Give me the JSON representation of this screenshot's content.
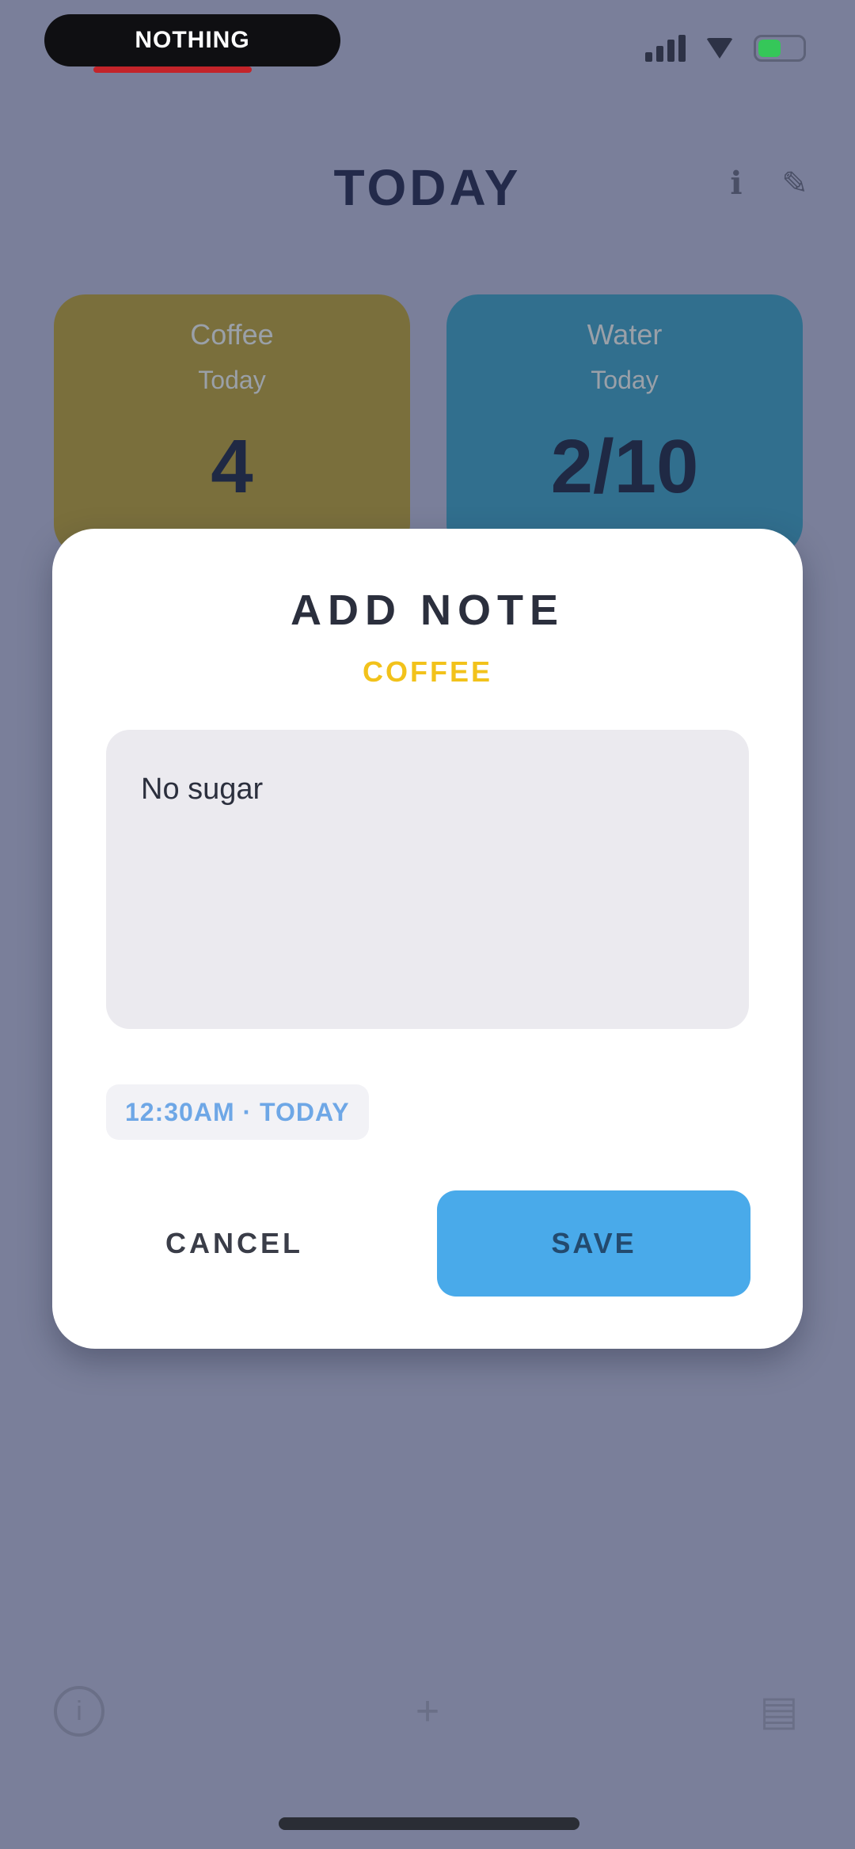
{
  "status_bar": {
    "brand_text": "NOTHING",
    "colors": {
      "battery": "#35c759",
      "brand_underline": "#c3242a"
    }
  },
  "header": {
    "title": "TODAY",
    "icons": [
      "info-icon",
      "edit-icon"
    ]
  },
  "cards": [
    {
      "label": "Coffee",
      "sub": "Today",
      "value": "4",
      "color": "#7a6f3c"
    },
    {
      "label": "Water",
      "sub": "Today",
      "value": "2/10",
      "color": "#316f8e"
    }
  ],
  "modal": {
    "title": "ADD NOTE",
    "subtitle": "COFFEE",
    "note_value": "No sugar",
    "date_chip": "12:30AM · TODAY",
    "cancel_label": "CANCEL",
    "save_label": "SAVE",
    "colors": {
      "accent": "#f2c21b",
      "save": "#49aaea",
      "chip_text": "#6ea7e6"
    }
  },
  "bottom_nav": {
    "icons": [
      "info-icon",
      "add-icon",
      "stats-icon"
    ]
  }
}
